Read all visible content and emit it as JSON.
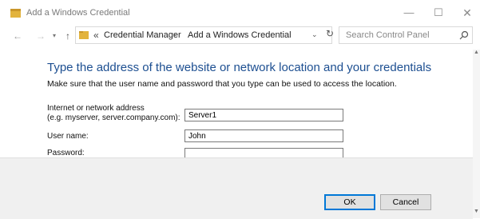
{
  "window": {
    "title": "Add a Windows Credential",
    "controls": {
      "minimize": "—",
      "maximize": "☐",
      "close": "✕"
    }
  },
  "nav": {
    "back": "←",
    "forward": "→",
    "recent": "▾",
    "up": "↑",
    "address_more": "«",
    "breadcrumbs": [
      "Credential Manager",
      "Add a Windows Credential"
    ],
    "separator": "›",
    "address_dropdown": "⌄",
    "refresh": "↻",
    "search_placeholder": "Search Control Panel"
  },
  "main": {
    "heading": "Type the address of the website or network location and your credentials",
    "subtext": "Make sure that the user name and password that you type can be used to access the location.",
    "fields": {
      "address_label_line1": "Internet or network address",
      "address_label_line2": "(e.g. myserver, server.company.com):",
      "address_value": "Server1",
      "username_label": "User name:",
      "username_value": "John",
      "password_label": "Password:",
      "password_value": ""
    }
  },
  "buttons": {
    "ok": "OK",
    "cancel": "Cancel"
  },
  "scrollbar": {
    "up": "▲",
    "down": "▼"
  },
  "colors": {
    "heading": "#1d4f91",
    "ok_border": "#0078d7",
    "folder_icon": "#e2b33d"
  }
}
